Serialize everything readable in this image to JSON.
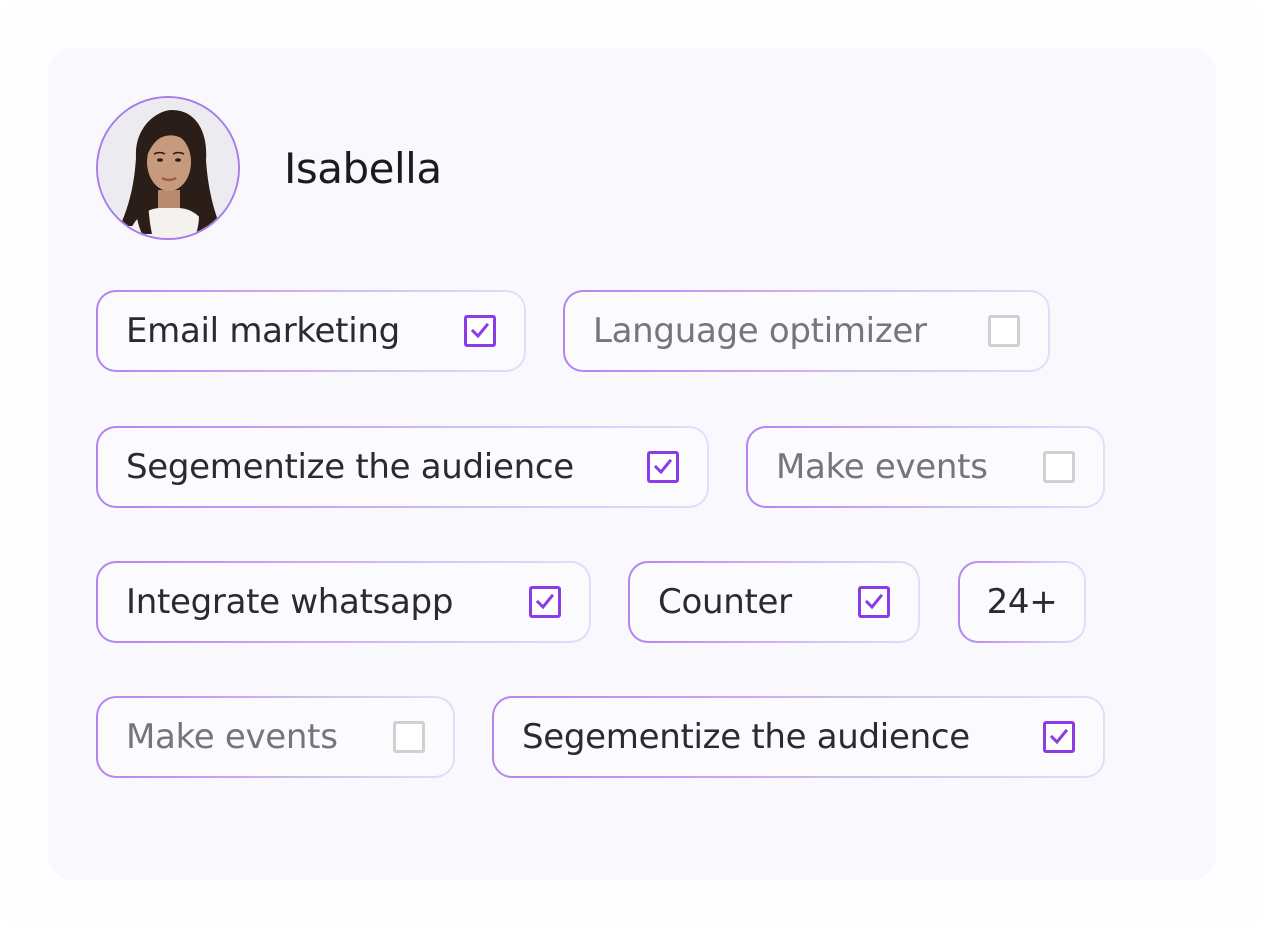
{
  "user": {
    "name": "Isabella",
    "avatar_icon": "user-avatar-photo"
  },
  "colors": {
    "accent": "#8a3ce6",
    "chip_border": "#b483f0",
    "unchecked": "#cfcfd4"
  },
  "chips": [
    {
      "label": "Email marketing",
      "checked": true
    },
    {
      "label": "Language optimizer",
      "checked": false
    },
    {
      "label": "Segementize the audience",
      "checked": true
    },
    {
      "label": "Make events",
      "checked": false
    },
    {
      "label": "Integrate whatsapp",
      "checked": true
    },
    {
      "label": "Counter",
      "checked": true
    },
    {
      "label": "24+"
    },
    {
      "label": "Make events",
      "checked": false
    },
    {
      "label": "Segementize the audience",
      "checked": true
    }
  ]
}
